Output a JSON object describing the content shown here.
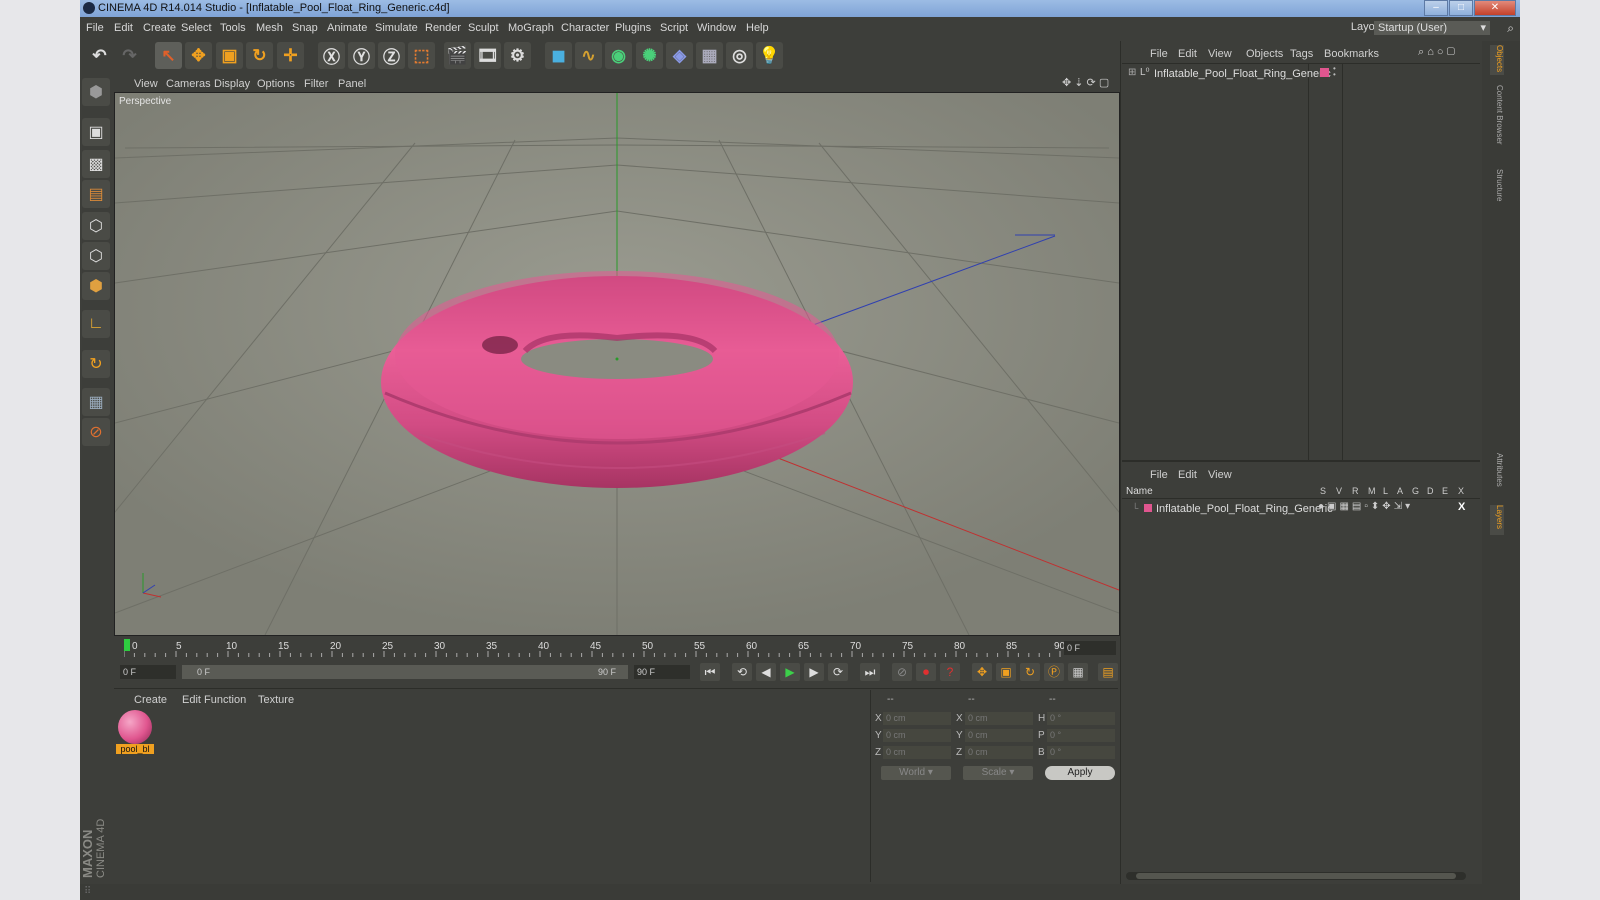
{
  "window": {
    "title": "CINEMA 4D R14.014 Studio - [Inflatable_Pool_Float_Ring_Generic.c4d]"
  },
  "menubar": {
    "items": [
      "File",
      "Edit",
      "Create",
      "Select",
      "Tools",
      "Mesh",
      "Snap",
      "Animate",
      "Simulate",
      "Render",
      "Sculpt",
      "MoGraph",
      "Character",
      "Plugins",
      "Script",
      "Window",
      "Help"
    ],
    "layout_label": "Layout:",
    "layout_value": "Startup (User)"
  },
  "viewport": {
    "menu": [
      "View",
      "Cameras",
      "Display",
      "Options",
      "Filter",
      "Panel"
    ],
    "label": "Perspective",
    "colors": {
      "torus": "#e0568f",
      "x_axis": "#c03030",
      "y_axis": "#2a9a2a",
      "z_axis": "#3040b0"
    }
  },
  "timeline": {
    "ticks": [
      "0",
      "5",
      "10",
      "15",
      "20",
      "25",
      "30",
      "35",
      "40",
      "45",
      "50",
      "55",
      "60",
      "65",
      "70",
      "75",
      "80",
      "85",
      "90"
    ],
    "current_frame": "0 F",
    "start_field": "0 F",
    "range_start": "0 F",
    "range_end": "90 F",
    "end_field": "90 F"
  },
  "material_panel": {
    "menu": [
      "Create",
      "Edit",
      "Function",
      "Texture"
    ],
    "materials": [
      {
        "name": "pool_bl",
        "color": "#e0568f"
      }
    ]
  },
  "coord_panel": {
    "headers": [
      "--",
      "--",
      "--"
    ],
    "rows": [
      {
        "a": "X",
        "av": "0 cm",
        "b": "X",
        "bv": "0 cm",
        "c": "H",
        "cv": "0 °"
      },
      {
        "a": "Y",
        "av": "0 cm",
        "b": "Y",
        "bv": "0 cm",
        "c": "P",
        "cv": "0 °"
      },
      {
        "a": "Z",
        "av": "0 cm",
        "b": "Z",
        "bv": "0 cm",
        "c": "B",
        "cv": "0 °"
      }
    ],
    "mode1": "World",
    "mode2": "Scale",
    "apply": "Apply"
  },
  "object_manager": {
    "menu": [
      "File",
      "Edit",
      "View",
      "Objects",
      "Tags",
      "Bookmarks"
    ],
    "object_name": "Inflatable_Pool_Float_Ring_Generic"
  },
  "layer_manager": {
    "menu": [
      "File",
      "Edit",
      "View"
    ],
    "name_header": "Name",
    "flags": [
      "S",
      "V",
      "R",
      "M",
      "L",
      "A",
      "G",
      "D",
      "E",
      "X"
    ],
    "layer_name": "Inflatable_Pool_Float_Ring_Generic",
    "layer_color": "#e0568f"
  },
  "side_tabs": [
    "Objects",
    "Content Browser",
    "Structure",
    "Attributes",
    "Layers"
  ],
  "brand": {
    "line1": "MAXON",
    "line2": "CINEMA 4D"
  }
}
